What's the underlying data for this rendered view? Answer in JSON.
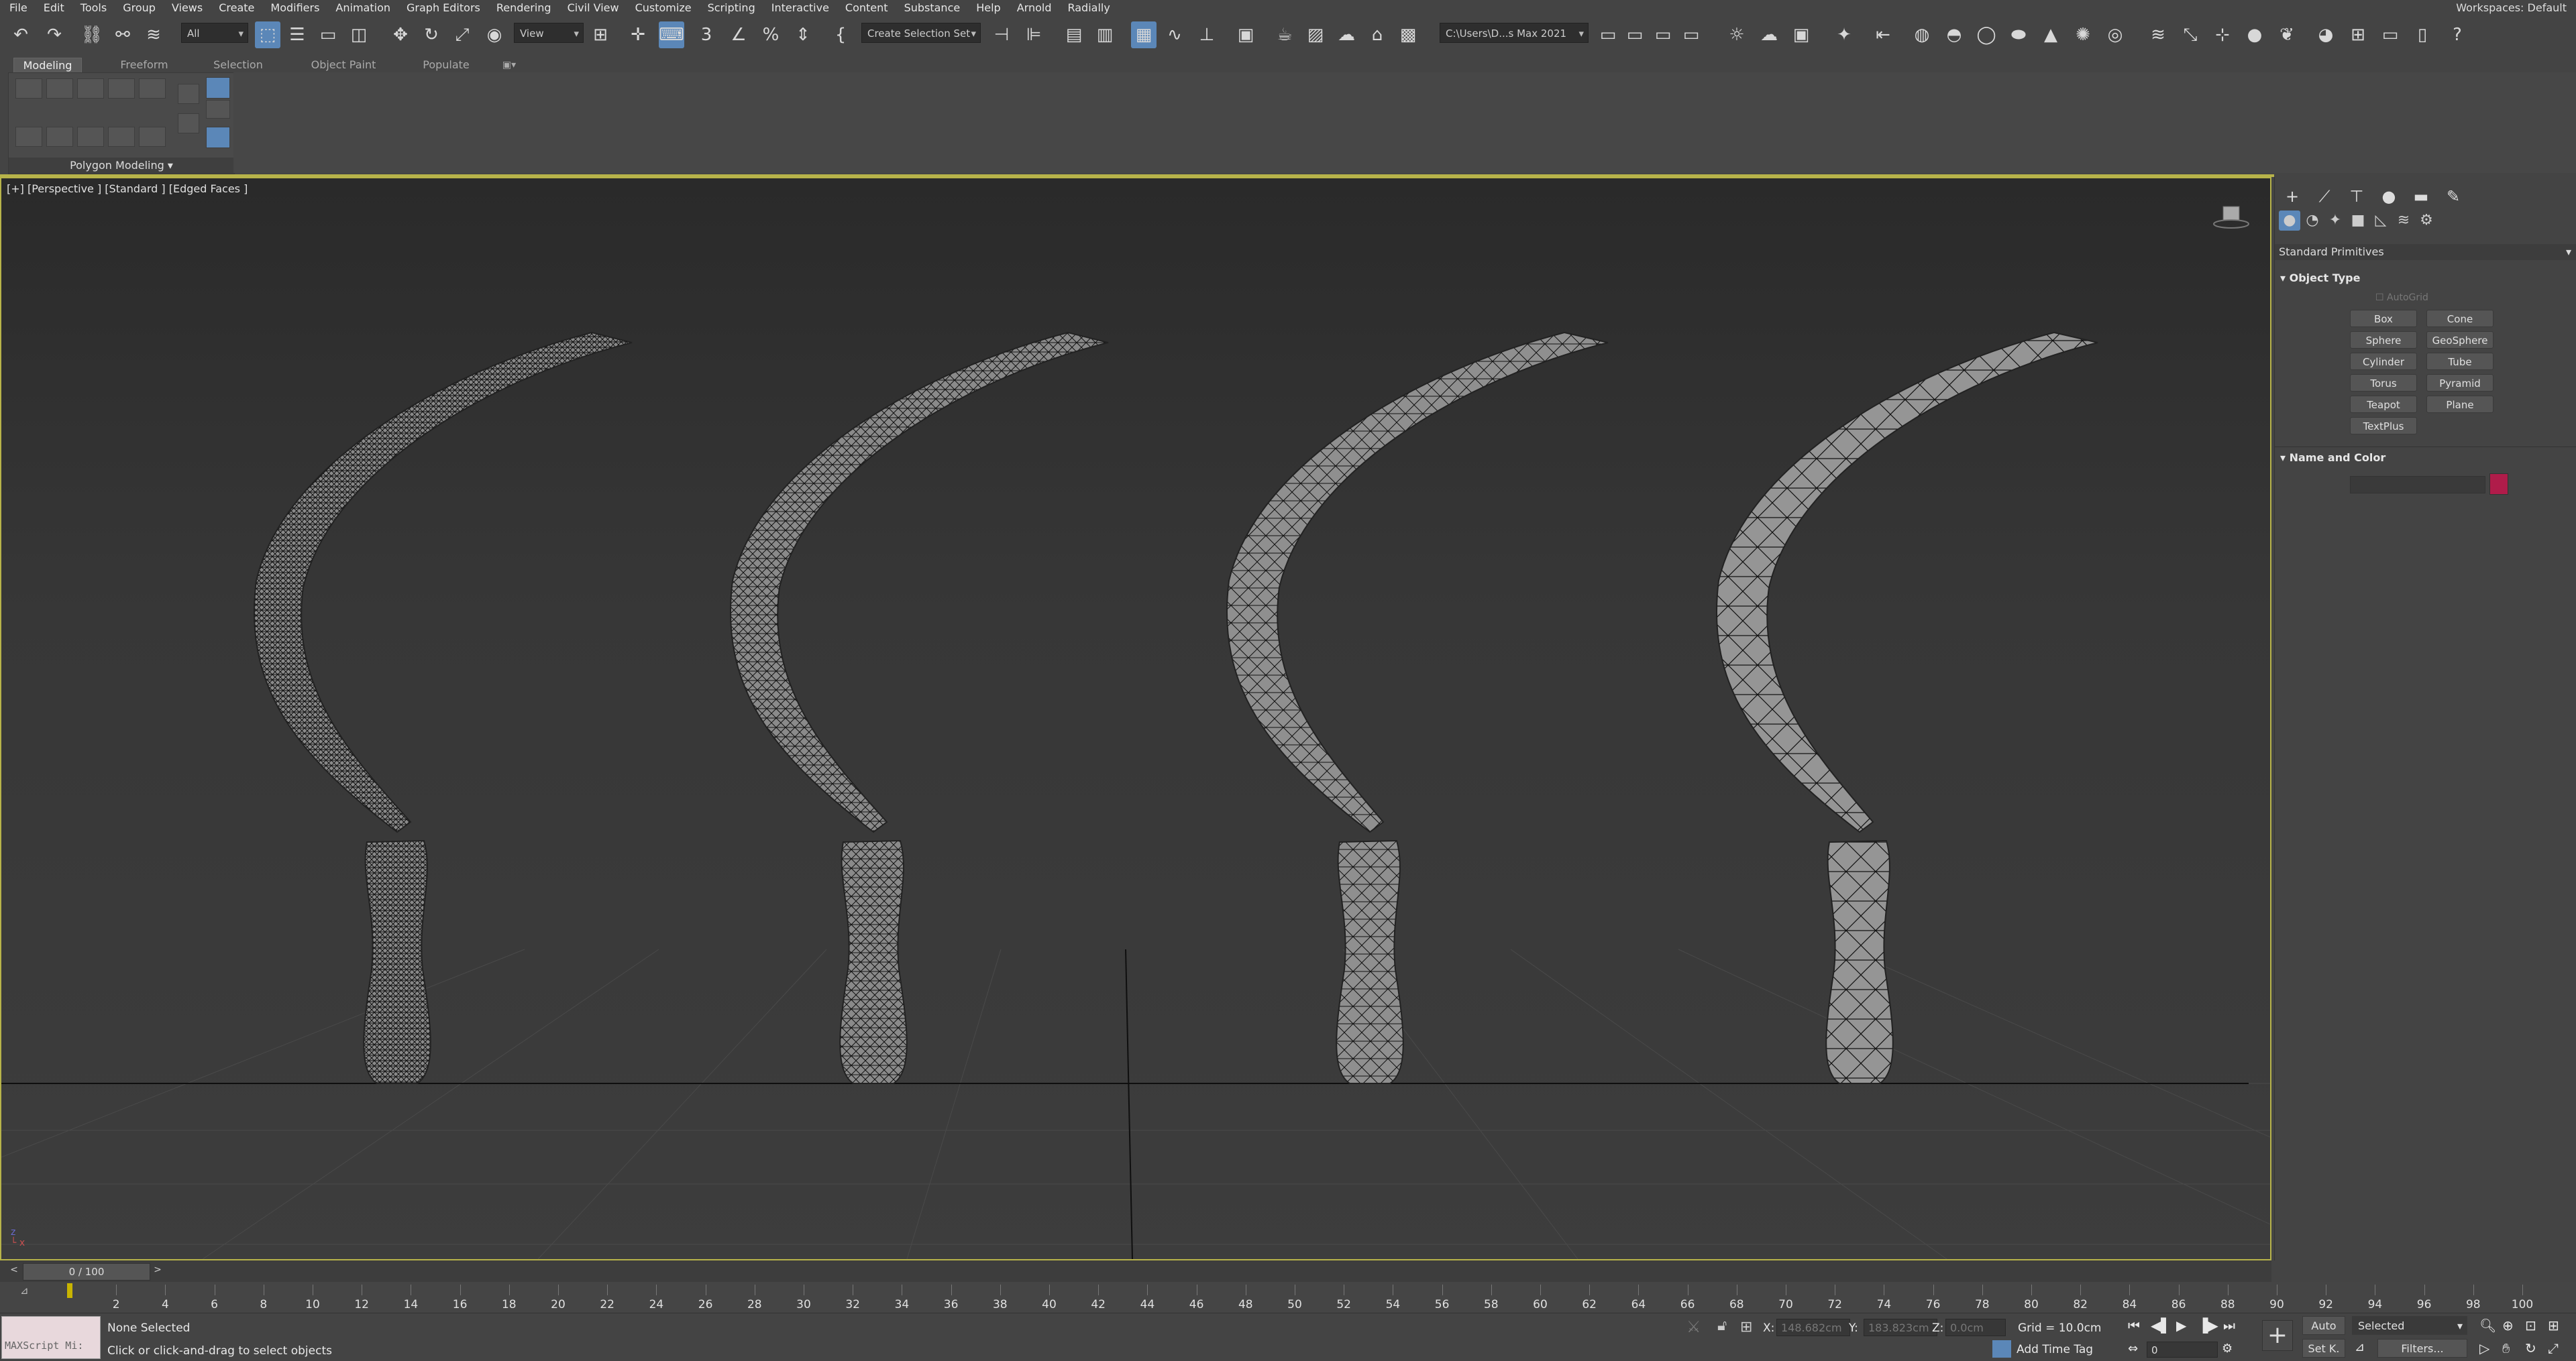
{
  "menu": [
    "File",
    "Edit",
    "Tools",
    "Group",
    "Views",
    "Create",
    "Modifiers",
    "Animation",
    "Graph Editors",
    "Rendering",
    "Civil View",
    "Customize",
    "Scripting",
    "Interactive",
    "Content",
    "Substance",
    "Help",
    "Arnold",
    "Radially"
  ],
  "workspace": {
    "label": "Workspaces:",
    "value": "Default"
  },
  "toolbar": {
    "selection_filter": "All",
    "reference_coord": "View",
    "named_selection": "Create Selection Set",
    "project_path": "C:\\Users\\D...s Max 2021"
  },
  "ribbon": {
    "tabs": [
      "Modeling",
      "Freeform",
      "Selection",
      "Object Paint",
      "Populate"
    ],
    "active_tab": "Modeling",
    "panel_label": "Polygon Modeling"
  },
  "viewport": {
    "label": "[+] [Perspective ] [Standard ] [Edged Faces ]"
  },
  "command_panel": {
    "category": "Standard Primitives",
    "object_type_title": "Object Type",
    "autogrid": "AutoGrid",
    "buttons": [
      "Box",
      "Cone",
      "Sphere",
      "GeoSphere",
      "Cylinder",
      "Tube",
      "Torus",
      "Pyramid",
      "Teapot",
      "Plane",
      "TextPlus"
    ],
    "name_color_title": "Name and Color",
    "object_color": "#b01c4a"
  },
  "timeline": {
    "frame_counter": "0 / 100",
    "ticks": [
      "2",
      "4",
      "6",
      "8",
      "10",
      "12",
      "14",
      "16",
      "18",
      "20",
      "22",
      "24",
      "26",
      "28",
      "30",
      "32",
      "34",
      "36",
      "38",
      "40",
      "42",
      "44",
      "46",
      "48",
      "50",
      "52",
      "54",
      "56",
      "58",
      "60",
      "62",
      "64",
      "66",
      "68",
      "70",
      "72",
      "74",
      "76",
      "78",
      "80",
      "82",
      "84",
      "86",
      "88",
      "90",
      "92",
      "94",
      "96",
      "98",
      "100"
    ]
  },
  "status": {
    "maxscript": "MAXScript Mi:",
    "selection": "None Selected",
    "prompt": "Click or click-and-drag to select objects",
    "x_label": "X:",
    "x_value": "148.682cm",
    "y_label": "Y:",
    "y_value": "183.823cm",
    "z_label": "Z:",
    "z_value": "0.0cm",
    "grid": "Grid = 10.0cm",
    "add_time_tag": "Add Time Tag",
    "auto_key": "Auto",
    "set_key": "Set K.",
    "selected_dropdown": "Selected",
    "filters": "Filters...",
    "frame_field": "0"
  }
}
